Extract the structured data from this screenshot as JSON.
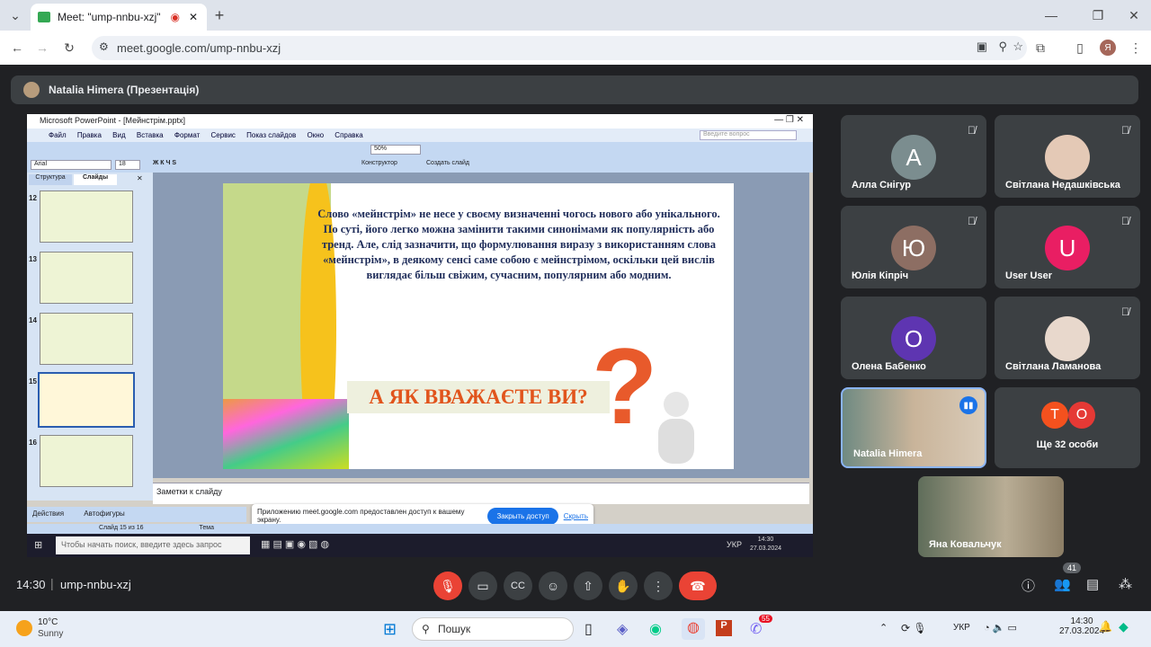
{
  "browser": {
    "tab_title": "Meet: \"ump-nnbu-xzj\"",
    "url": "meet.google.com/ump-nnbu-xzj",
    "profile_initial": "Я"
  },
  "meet": {
    "presenter_label": "Natalia Himera (Презентація)",
    "time": "14:30",
    "meeting_code": "ump-nnbu-xzj",
    "people_count": "41",
    "participants": [
      {
        "name": "Алла Снігур",
        "initial": "A",
        "color": "#7b8d8f"
      },
      {
        "name": "Світлана Недашківська",
        "initial": "",
        "color": "#c9a"
      },
      {
        "name": "Юлія Кіпріч",
        "initial": "Ю",
        "color": "#8d6e63"
      },
      {
        "name": "User User",
        "initial": "U",
        "color": "#e91e63"
      },
      {
        "name": "Олена Бабенко",
        "initial": "O",
        "color": "#5e35b1"
      },
      {
        "name": "Світлана Ламанова",
        "initial": "",
        "color": "#caa"
      },
      {
        "name": "Natalia Himera",
        "initial": "",
        "color": "#7b8"
      },
      {
        "name": "Ще 32 особи",
        "initial": "",
        "color": "#3c4043"
      },
      {
        "name": "Яна Ковальчук",
        "initial": "",
        "color": "#9a8"
      }
    ],
    "more_avatars": [
      "T",
      "O"
    ]
  },
  "ppt": {
    "window_title": "Microsoft PowerPoint - [Мейнстрім.pptx]",
    "menu": [
      "Файл",
      "Правка",
      "Вид",
      "Вставка",
      "Формат",
      "Сервис",
      "Показ слайдов",
      "Окно",
      "Справка"
    ],
    "help_placeholder": "Введите вопрос",
    "font": "Arial",
    "font_size": "18",
    "zoom": "50%",
    "designer": "Конструктор",
    "create_slide": "Создать слайд",
    "pane_tabs": [
      "Структура",
      "Слайды"
    ],
    "thumb_numbers": [
      "12",
      "13",
      "14",
      "15",
      "16"
    ],
    "slide_text": "Слово «мейнстрім» не несе у своєму визначенні чогось нового або унікального. По суті, його легко можна замінити такими синонімами як популярність або тренд. Але, слід зазначити, що формулювання виразу з використанням слова «мейнстрім», в деякому сенсі саме собою є мейнстрімом, оскільки цей вислів виглядає більш свіжим, сучасним, популярним або модним.",
    "slide_question": "А ЯК ВВАЖАЄТЕ ВИ?",
    "notes": "Заметки к слайду",
    "actions": "Действия",
    "autoshapes": "Автофигуры",
    "status_slide": "Слайд 15 из 16",
    "status_theme": "Тема",
    "share_notice": "Приложению meet.google.com предоставлен доступ к вашему экрану.",
    "stop_sharing": "Закрыть доступ",
    "hide": "Скрыть",
    "inner_search": "Чтобы начать поиск, введите здесь запрос",
    "inner_lang": "УКР",
    "inner_time": "14:30",
    "inner_date": "27.03.2024"
  },
  "taskbar": {
    "weather_temp": "10°C",
    "weather_desc": "Sunny",
    "search": "Пошук",
    "lang": "УКР",
    "time": "14:30",
    "date": "27.03.2024",
    "badge": "55"
  }
}
